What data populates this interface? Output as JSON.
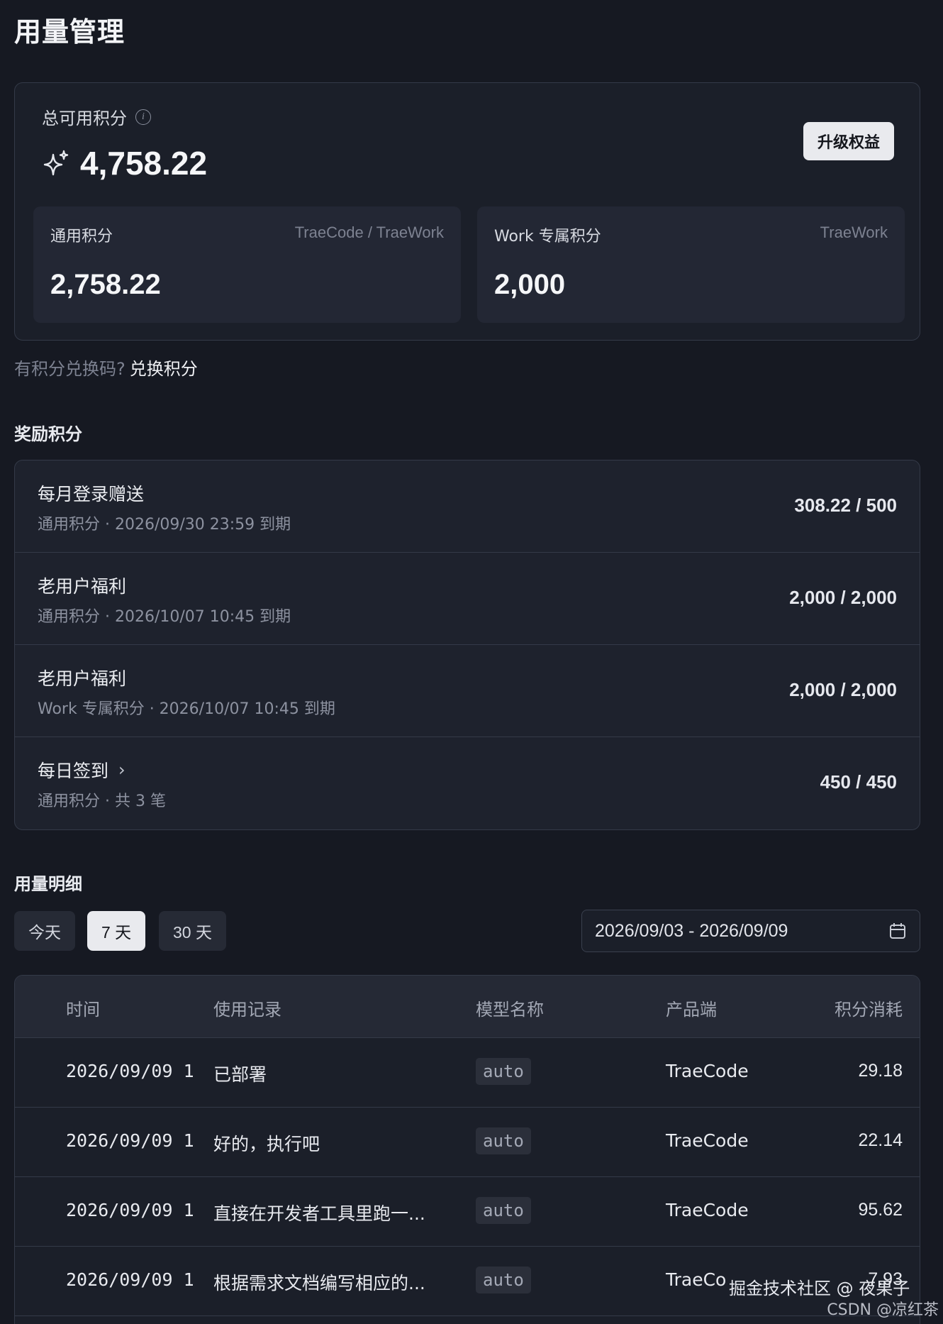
{
  "page": {
    "title": "用量管理"
  },
  "summary": {
    "total_label": "总可用积分",
    "total_value": "4,758.22",
    "upgrade_label": "升级权益",
    "general": {
      "title": "通用积分",
      "tag": "TraeCode / TraeWork",
      "value": "2,758.22"
    },
    "work": {
      "title": "Work 专属积分",
      "tag": "TraeWork",
      "value": "2,000"
    }
  },
  "redeem": {
    "hint": "有积分兑换码?",
    "link": "兑换积分"
  },
  "rewards": {
    "title": "奖励积分",
    "items": [
      {
        "name": "每月登录赠送",
        "meta": "通用积分 · 2026/09/30 23:59 到期",
        "amount": "308.22 / 500"
      },
      {
        "name": "老用户福利",
        "meta": "通用积分 · 2026/10/07 10:45 到期",
        "amount": "2,000 / 2,000"
      },
      {
        "name": "老用户福利",
        "meta": "Work 专属积分 · 2026/10/07 10:45 到期",
        "amount": "2,000 / 2,000"
      },
      {
        "name": "每日签到",
        "meta": "通用积分 · 共 3 笔",
        "amount": "450 / 450"
      }
    ]
  },
  "usage": {
    "title": "用量明细",
    "filters": [
      "今天",
      "7 天",
      "30 天"
    ],
    "active_filter": "7 天",
    "date_range": "2026/09/03  -  2026/09/09",
    "columns": [
      "时间",
      "使用记录",
      "模型名称",
      "产品端",
      "积分消耗"
    ],
    "rows": [
      {
        "time": "2026/09/09 1",
        "record": "已部署",
        "model": "auto",
        "product": "TraeCode",
        "cost": "29.18"
      },
      {
        "time": "2026/09/09 1",
        "record": "好的，执行吧",
        "model": "auto",
        "product": "TraeCode",
        "cost": "22.14"
      },
      {
        "time": "2026/09/09 1",
        "record": "直接在开发者工具里跑一...",
        "model": "auto",
        "product": "TraeCode",
        "cost": "95.62"
      },
      {
        "time": "2026/09/09 1",
        "record": "根据需求文档编写相应的...",
        "model": "auto",
        "product": "TraeCo",
        "cost": "7.93"
      }
    ]
  },
  "watermark": {
    "line1": "掘金技术社区 @ 夜果子",
    "line2": "CSDN @凉红茶"
  }
}
